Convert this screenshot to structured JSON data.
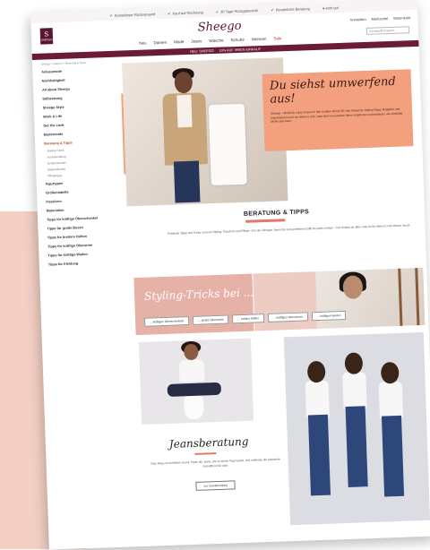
{
  "topbar": {
    "items": [
      "Kostenloser Rückversand",
      "Kauf auf Rechnung",
      "30 Tage Rückgaberecht",
      "Persönliche Beratung"
    ],
    "rating_label": "sehr gut"
  },
  "header": {
    "logo_letter": "S",
    "logo_sub": "SHEEGO",
    "brand": "Sheego",
    "utility": [
      "Anmelden",
      "Merkzettel",
      "Warenkorb"
    ],
    "search_placeholder": "Suchbegriff eingeben"
  },
  "nav": {
    "items": [
      "Neu",
      "Damen",
      "Mode",
      "Jeans",
      "Wäsche",
      "Schuhe",
      "Wohnen"
    ],
    "sale_label": "Sale"
  },
  "promo": {
    "items": [
      "NEU: SHEEGO",
      "10% AUF IHREN EINKAUF"
    ]
  },
  "breadcrumb": "Sheego > Damen > Beratung & Tipps",
  "sidebar": {
    "items": [
      {
        "label": "Anlassmode",
        "active": false
      },
      {
        "label": "Nachhaltigkeit",
        "active": false
      },
      {
        "label": "All about Sheego",
        "active": false
      },
      {
        "label": "Stilberatung",
        "active": false
      },
      {
        "label": "Sheego Style",
        "active": false
      },
      {
        "label": "Work & Life",
        "active": false
      },
      {
        "label": "Get the Look",
        "active": false
      },
      {
        "label": "Modetrends",
        "active": false
      },
      {
        "label": "Beratung & Tipps",
        "active": true
      }
    ],
    "subitems": [
      "Styling-Tricks",
      "Jeansberatung",
      "Größenberater",
      "Materialkunde",
      "Pflegetipps"
    ],
    "items2": [
      {
        "label": "Figurtypen"
      },
      {
        "label": "Größentabelle"
      },
      {
        "label": "Passform"
      },
      {
        "label": "Materialien"
      },
      {
        "label": "Tipps für kräftige Oberschenkel"
      },
      {
        "label": "Tipps für große Busen"
      },
      {
        "label": "Tipps für breitere Hüften"
      },
      {
        "label": "Tipps für kräftige Oberarme"
      },
      {
        "label": "Tipps für kräftige Waden"
      },
      {
        "label": "Tipps für Kleidung"
      }
    ]
  },
  "hero": {
    "title": "Du siehst umwerfend aus!",
    "text": "Sheego – Mode für curvy Frauen in den Größen 40 bis 58. Hier findest du Styling-Tipps, Ratgeber und Inspirationen rund um deinen Look. Lass dich von unseren Ideen inspirieren und entdecke, wie vielseitig Mode sein kann."
  },
  "tips": {
    "title": "BERATUNG & TIPPS",
    "text": "Entdecke Tipps und Tricks rund um Styling, Passform und Pflege. Von der richtigen Jeans bis zum perfekten Outfit für jeden Anlass – hier findest du alles, was du für deinen Look wissen musst."
  },
  "styling": {
    "title": "Styling-Tricks bei ...",
    "buttons": [
      "... kräftigen Oberschenkeln",
      "... großer Oberweite",
      "... breiten Hüften",
      "... kräftigen Oberarmen",
      "... kräftigen Waden"
    ]
  },
  "jeans": {
    "title": "Jeansberatung",
    "text": "Dein Weg zur perfekten Jeans: Finde die Jeans, die zu deiner Figur passt, und entdecke die passende Schnittform für dich.",
    "button": "zur Jeansberatung"
  }
}
